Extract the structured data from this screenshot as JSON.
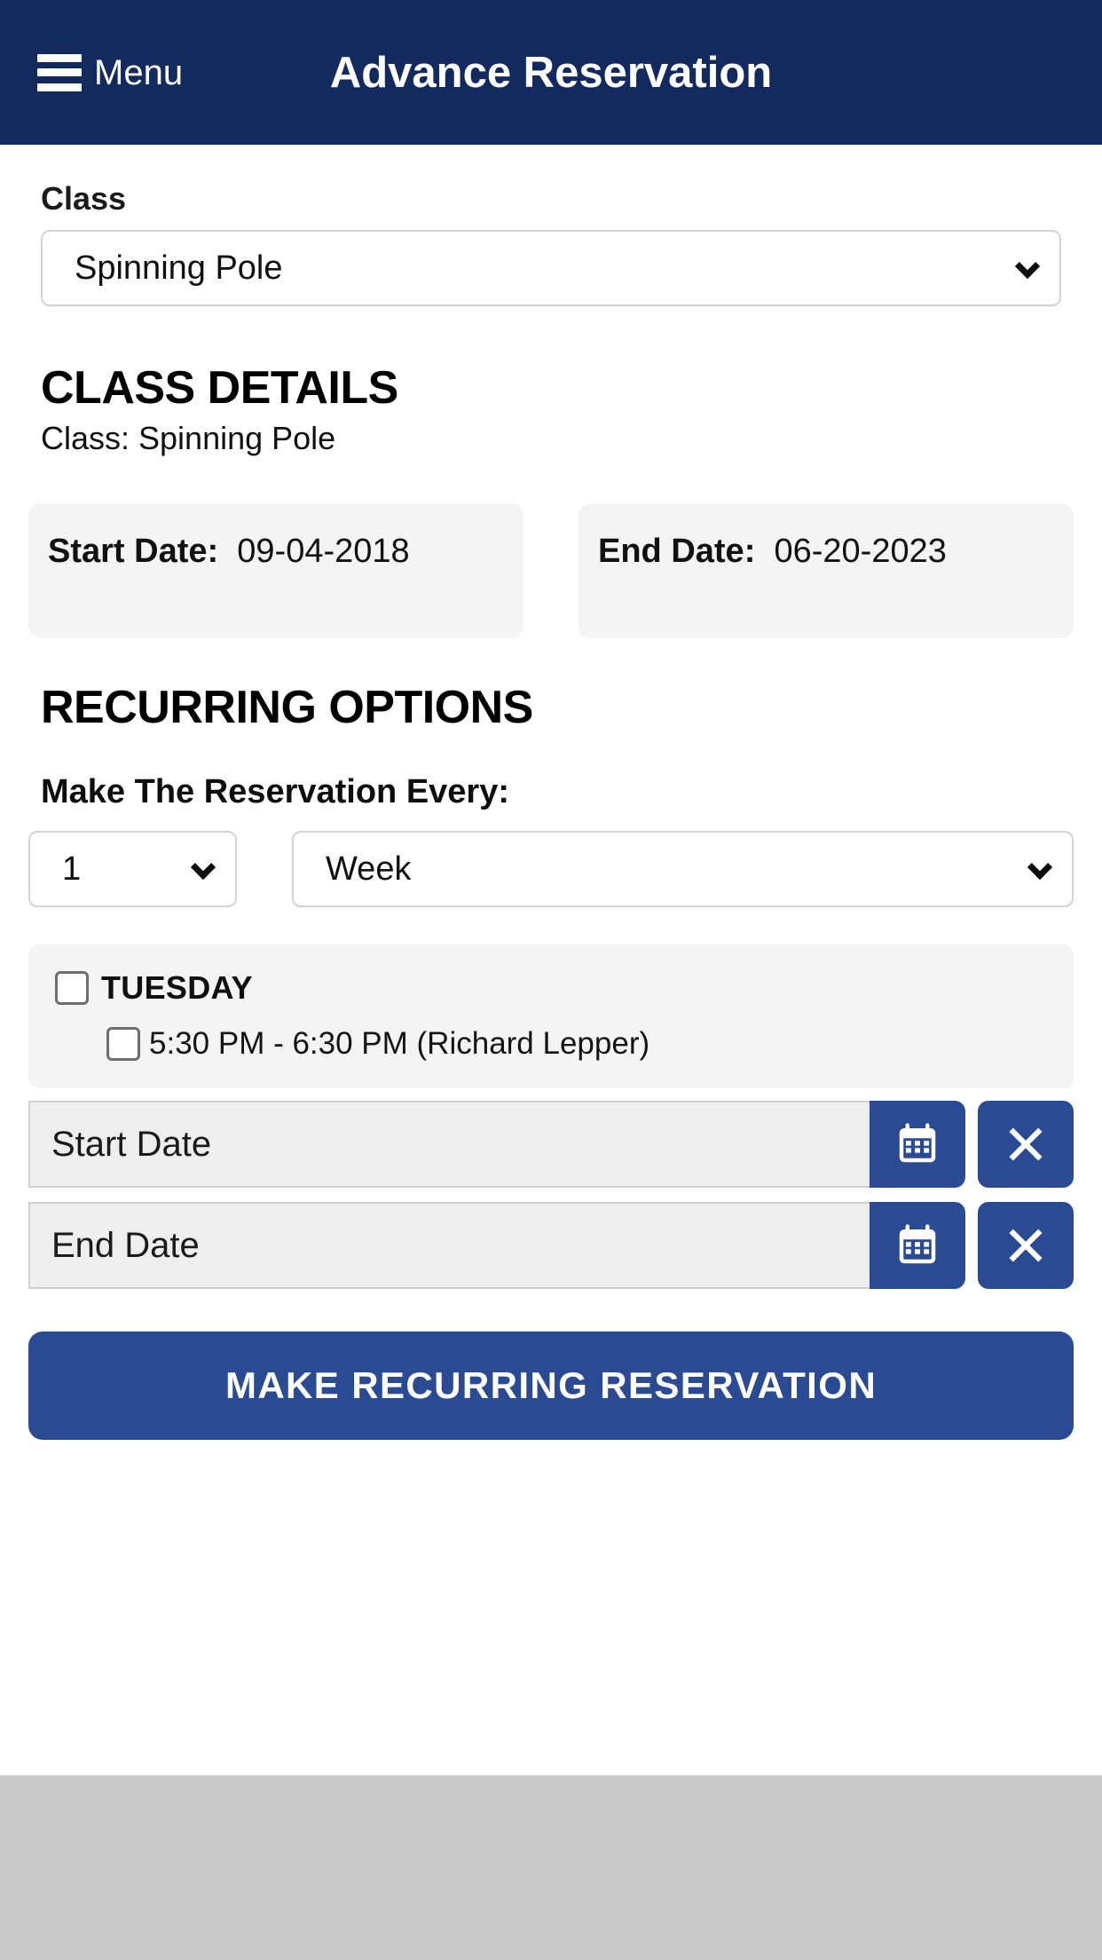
{
  "header": {
    "menu_label": "Menu",
    "menu_icon": "hamburger-icon",
    "title": "Advance Reservation"
  },
  "class_field": {
    "label": "Class",
    "selected": "Spinning Pole",
    "chevron_icon": "chevron-down-icon",
    "options": [
      "Spinning Pole"
    ]
  },
  "class_details": {
    "heading": "CLASS DETAILS",
    "class_line_label": "Class:",
    "class_line_value": "Spinning Pole",
    "class_line": "Class: Spinning Pole",
    "start_card": {
      "label": "Start Date:",
      "value": "09-04-2018"
    },
    "end_card": {
      "label": "End Date:",
      "value": "06-20-2023"
    }
  },
  "recurring": {
    "heading": "RECURRING OPTIONS",
    "prompt": "Make The Reservation Every:",
    "interval_count": {
      "selected": "1",
      "options": [
        "1"
      ]
    },
    "interval_unit": {
      "selected": "Week",
      "options": [
        "Week"
      ]
    },
    "days": [
      {
        "name": "TUESDAY",
        "checked": false,
        "slots": [
          {
            "label": "5:30 PM - 6:30 PM (Richard Lepper)",
            "checked": false
          }
        ]
      }
    ]
  },
  "date_range": {
    "start": {
      "placeholder": "Start Date",
      "value": "",
      "calendar_icon": "calendar-icon",
      "clear_icon": "close-x-icon"
    },
    "end": {
      "placeholder": "End Date",
      "value": "",
      "calendar_icon": "calendar-icon",
      "clear_icon": "close-x-icon"
    }
  },
  "submit": {
    "label": "MAKE RECURRING RESERVATION"
  },
  "colors": {
    "header_navy": "#132a5e",
    "accent_blue": "#2a4b94",
    "card_gray": "#f4f4f4",
    "input_gray": "#eeeeee",
    "footer_gray": "#c9c9c9"
  }
}
